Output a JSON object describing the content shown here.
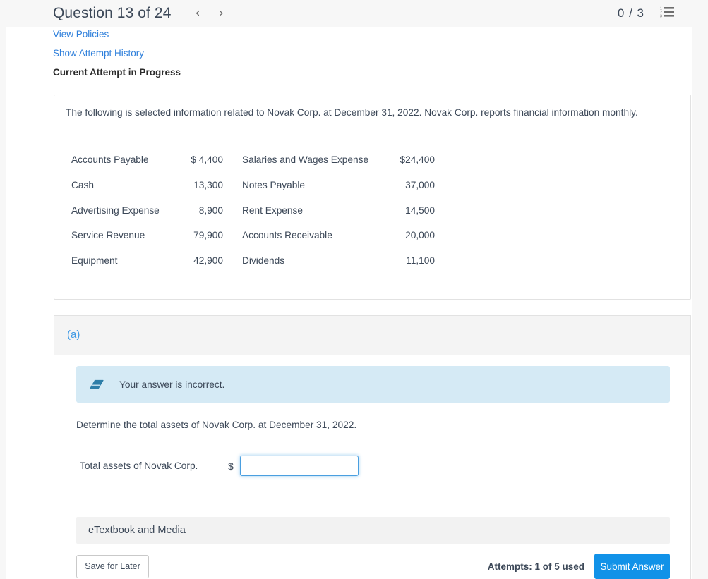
{
  "header": {
    "question_title": "Question 13 of 24",
    "prev_icon": "chevron-left-icon",
    "next_icon": "chevron-right-icon",
    "prev_glyph": "‹",
    "next_glyph": "›",
    "score": "0 / 3",
    "list_icon": "numbered-list-icon"
  },
  "links": {
    "view_policies": "View Policies",
    "show_attempt_history": "Show Attempt History",
    "current_attempt": "Current Attempt in Progress"
  },
  "info": {
    "intro": "The following is selected information related to Novak Corp. at December 31, 2022. Novak Corp. reports financial information monthly.",
    "rows": [
      {
        "label_a": "Accounts Payable",
        "value_a": "$ 4,400",
        "label_b": "Salaries and Wages Expense",
        "value_b": "$24,400"
      },
      {
        "label_a": "Cash",
        "value_a": "13,300",
        "label_b": "Notes Payable",
        "value_b": "37,000"
      },
      {
        "label_a": "Advertising Expense",
        "value_a": "8,900",
        "label_b": "Rent Expense",
        "value_b": "14,500"
      },
      {
        "label_a": "Service Revenue",
        "value_a": "79,900",
        "label_b": "Accounts Receivable",
        "value_b": "20,000"
      },
      {
        "label_a": "Equipment",
        "value_a": "42,900",
        "label_b": "Dividends",
        "value_b": "11,100"
      }
    ]
  },
  "section": {
    "letter": "(a)",
    "alert": {
      "icon": "eraser-icon",
      "text": "Your answer is incorrect."
    },
    "prompt": "Determine the total assets of Novak Corp. at December 31, 2022.",
    "answer_label": "Total assets of Novak Corp.",
    "currency_symbol": "$",
    "answer_value": "",
    "answer_placeholder": ""
  },
  "footer": {
    "etextbook_label": "eTextbook and Media",
    "save_for_later": "Save for Later",
    "attempts": "Attempts: 1 of 5 used",
    "submit_answer": "Submit Answer"
  },
  "colors": {
    "accent_blue": "#1192e8",
    "link_blue": "#2e7fdb",
    "section_letter_blue": "#3f9ae5",
    "alert_bg": "#d5eaf5",
    "panel_border": "#e2e2e2",
    "header_bg": "#f7f7f7",
    "text": "#3c4858"
  }
}
